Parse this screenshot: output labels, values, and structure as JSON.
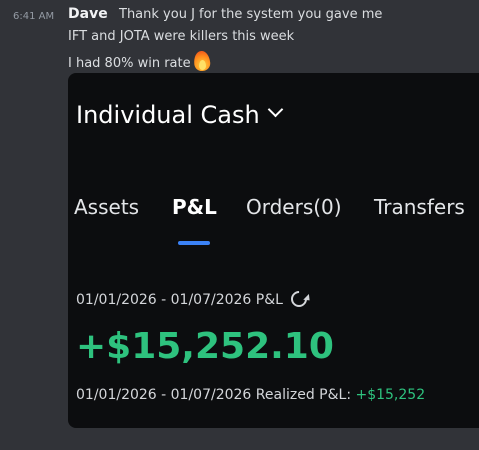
{
  "message": {
    "timestamp": "6:41 AM",
    "author": "Dave",
    "lines": [
      "Thank you J for the system you gave me",
      "IFT and JOTA were killers this week",
      "I had 80% win rate"
    ],
    "emoji": "fire-icon"
  },
  "attachment": {
    "account_title": "Individual Cash",
    "tabs": [
      {
        "label": "Assets",
        "active": false
      },
      {
        "label": "P&L",
        "active": true
      },
      {
        "label": "Orders(0)",
        "active": false
      },
      {
        "label": "Transfers",
        "active": false
      }
    ],
    "accent_color": "#3b82f6",
    "period_label": "01/01/2026 - 01/07/2026 P&L",
    "pnl_value": "+$15,252.10",
    "gain_color": "#2ec27e",
    "realized_label": "01/01/2026 - 01/07/2026 Realized P&L:",
    "realized_value": "+$15,252"
  }
}
